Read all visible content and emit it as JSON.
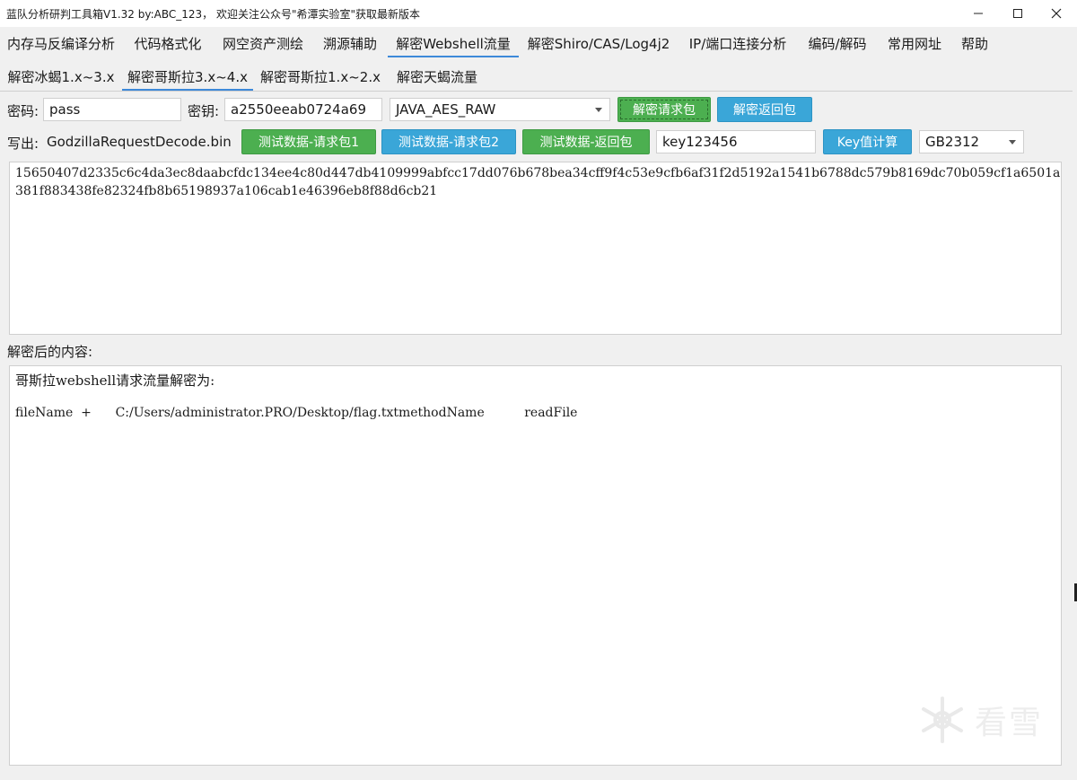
{
  "window": {
    "title": "蓝队分析研判工具箱V1.32 by:ABC_123， 欢迎关注公众号\"希潭实验室\"获取最新版本"
  },
  "menu": [
    {
      "label": "内存马反编译分析"
    },
    {
      "label": "代码格式化"
    },
    {
      "label": "网空资产测绘"
    },
    {
      "label": "溯源辅助"
    },
    {
      "label": "解密Webshell流量",
      "active": true
    },
    {
      "label": "解密Shiro/CAS/Log4j2"
    },
    {
      "label": "IP/端口连接分析"
    },
    {
      "label": "编码/解码"
    },
    {
      "label": "常用网址"
    },
    {
      "label": "帮助"
    }
  ],
  "subtabs": [
    {
      "label": "解密冰蝎1.x~3.x"
    },
    {
      "label": "解密哥斯拉3.x~4.x",
      "active": true
    },
    {
      "label": "解密哥斯拉1.x~2.x"
    },
    {
      "label": "解密天蝎流量"
    }
  ],
  "row1": {
    "password_label": "密码:",
    "password_value": "pass",
    "key_label": "密钥:",
    "key_value": "a2550eeab0724a69",
    "mode_selected": "JAVA_AES_RAW",
    "decrypt_request_label": "解密请求包",
    "decrypt_response_label": "解密返回包"
  },
  "row2": {
    "output_label": "写出:",
    "output_file": "GodzillaRequestDecode.bin",
    "test_req1_label": "测试数据-请求包1",
    "test_req2_label": "测试数据-请求包2",
    "test_resp_label": "测试数据-返回包",
    "key_input_value": "key123456",
    "key_calc_label": "Key值计算",
    "encoding_selected": "GB2312"
  },
  "input_area": {
    "lines": [
      "15650407d2335c6c4da3ec8daabcfdc134ee4c80d447db4109999abfcc17dd076b678bea34cff9f4c53e9cfb6af31f2d5192a1541b6788dc579b8169dc70b059cf1a6501a",
      "381f883438fe82324fb8b65198937a106cab1e46396eb8f88d6cb21"
    ]
  },
  "output_area": {
    "label": "解密后的内容:",
    "heading": "哥斯拉webshell请求流量解密为:",
    "line": "fileName  +      C:/Users/administrator.PRO/Desktop/flag.txtmethodName          readFile"
  },
  "watermark": {
    "text": "看雪"
  },
  "icons": {
    "minimize": "minimize-icon",
    "maximize": "maximize-icon",
    "close": "close-icon",
    "dropdown": "chevron-down-icon",
    "watermark_logo": "snowflake-icon"
  }
}
